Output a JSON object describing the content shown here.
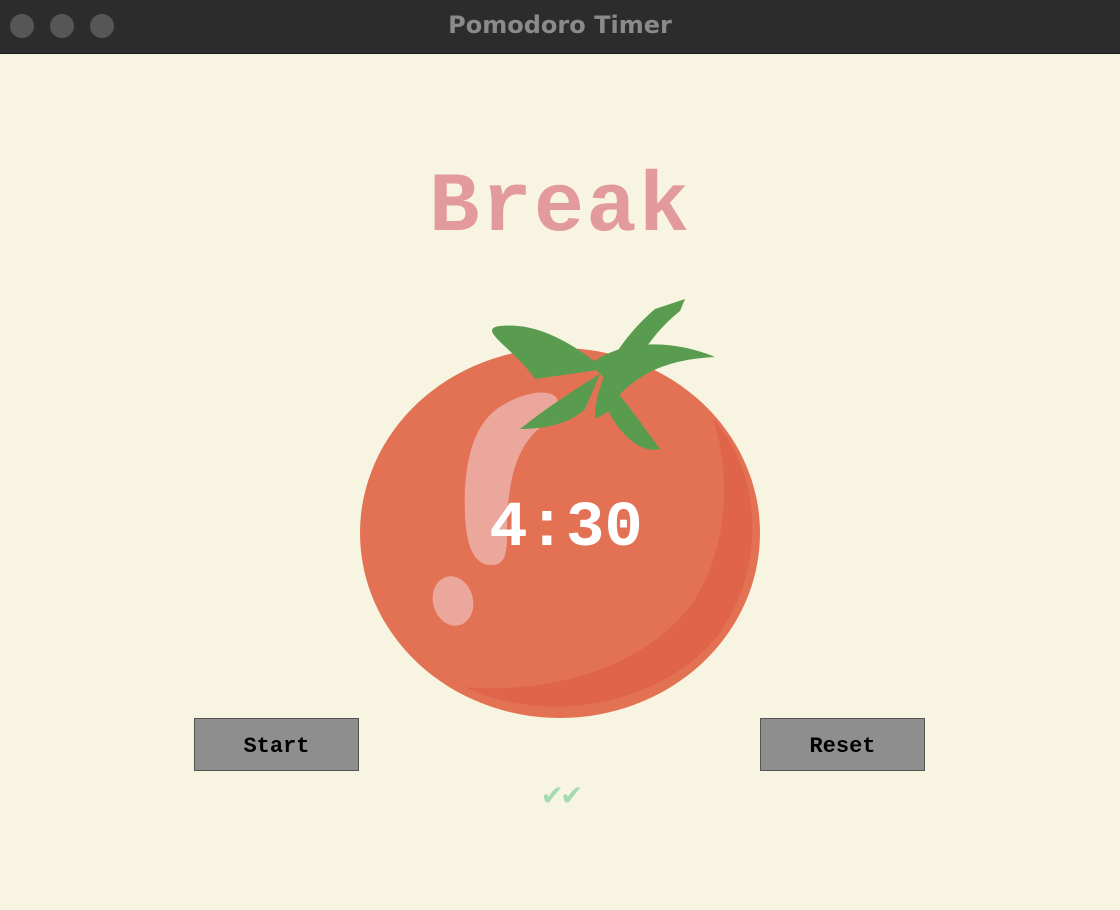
{
  "window": {
    "title": "Pomodoro Timer"
  },
  "timer": {
    "mode_label": "Break",
    "time_display": "4:30",
    "checkmarks": "✔✔"
  },
  "controls": {
    "start_label": "Start",
    "reset_label": "Reset"
  },
  "icons": {
    "tomato": "tomato-icon",
    "window_close": "close-icon",
    "window_minimize": "minimize-icon",
    "window_zoom": "zoom-icon",
    "checkmark": "checkmark-icon"
  },
  "colors": {
    "background": "#f7f5e1",
    "mode_label": "#e39a9d",
    "tomato_body": "#e37254",
    "tomato_shade": "#e0644a",
    "tomato_leaf": "#5a9c4f",
    "timer_text": "#ffffff",
    "button_bg": "#8e8e8e",
    "checkmark": "#a7dab3",
    "titlebar": "#2c2c2c"
  }
}
